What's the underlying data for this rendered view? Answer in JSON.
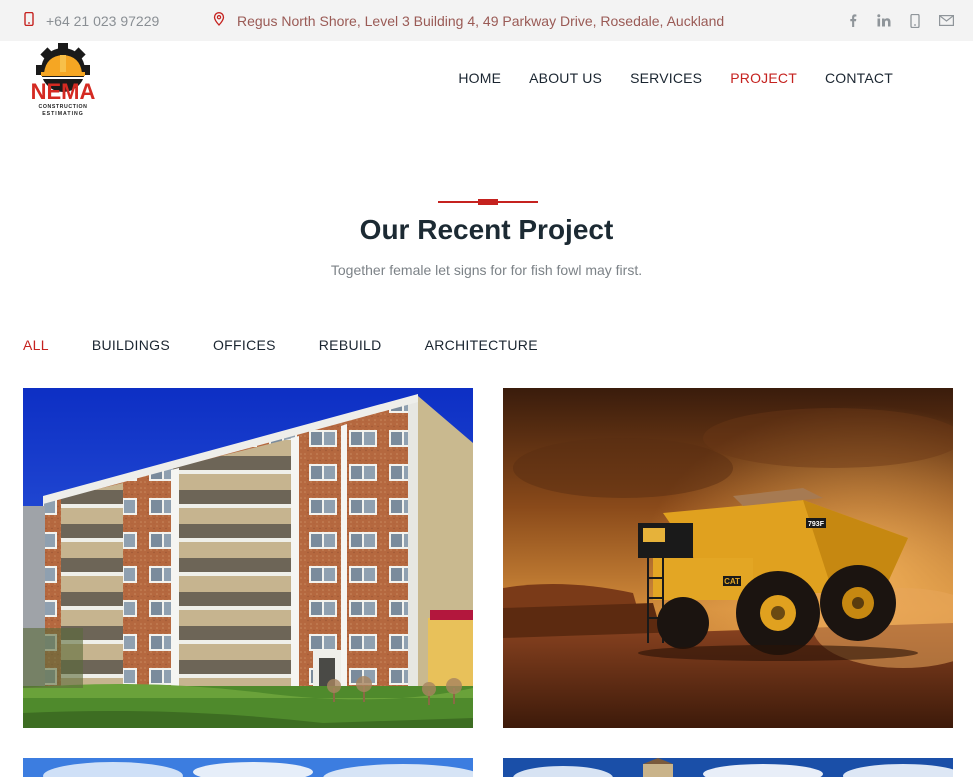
{
  "topbar": {
    "phone_icon": "phone-icon",
    "phone": "+64 21 023 97229",
    "location_icon": "map-pin-icon",
    "address": "Regus North Shore, Level 3 Building 4, 49 Parkway Drive, Rosedale, Auckland",
    "social": [
      {
        "icon": "facebook-icon",
        "glyph": "f"
      },
      {
        "icon": "linkedin-icon",
        "glyph": "in"
      },
      {
        "icon": "mobile-icon",
        "glyph": "▯"
      },
      {
        "icon": "mail-icon",
        "glyph": "✉"
      }
    ]
  },
  "logo": {
    "brand": "NEMA",
    "line1": "CONSTRUCTION",
    "line2": "ESTIMATING"
  },
  "nav": {
    "home": "HOME",
    "about": "ABOUT US",
    "services": "SERVICES",
    "project": "PROJECT",
    "contact": "CONTACT"
  },
  "section": {
    "title": "Our Recent Project",
    "subtitle": "Together female let signs for for fish fowl may first."
  },
  "filters": {
    "all": "ALL",
    "buildings": "BUILDINGS",
    "offices": "OFFICES",
    "rebuild": "REBUILD",
    "architecture": "ARCHITECTURE"
  },
  "colors": {
    "accent": "#c5221f",
    "topbar_bg": "#f3f3f3",
    "heading": "#1c2a33"
  },
  "projects": [
    {
      "image": "apartment-building-photo",
      "truck_plate": ""
    },
    {
      "image": "mining-dump-truck-photo",
      "truck_plate": "793F",
      "truck_brand": "CAT"
    },
    {
      "image": "project-photo-3"
    },
    {
      "image": "project-photo-4"
    }
  ]
}
